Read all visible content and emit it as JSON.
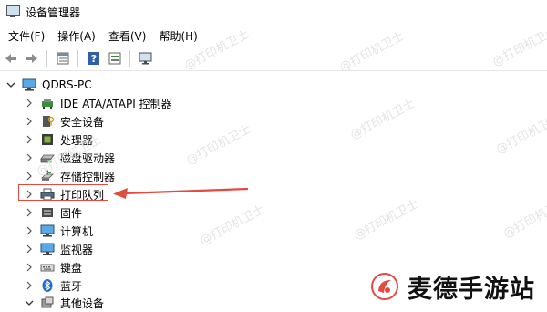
{
  "window": {
    "title": "设备管理器"
  },
  "menu": [
    {
      "label": "文件(F)"
    },
    {
      "label": "操作(A)"
    },
    {
      "label": "查看(V)"
    },
    {
      "label": "帮助(H)"
    }
  ],
  "toolbar": [
    "back-icon",
    "forward-icon",
    "properties-icon",
    "help-icon",
    "view-icon",
    "monitor-scan-icon"
  ],
  "tree": {
    "root": "QDRS-PC",
    "items": [
      {
        "label": "IDE ATA/ATAPI 控制器",
        "icon": "ide-controller-icon"
      },
      {
        "label": "安全设备",
        "icon": "security-device-icon"
      },
      {
        "label": "处理器",
        "icon": "processor-icon"
      },
      {
        "label": "磁盘驱动器",
        "icon": "disk-drive-icon"
      },
      {
        "label": "存储控制器",
        "icon": "storage-controller-icon"
      },
      {
        "label": "打印队列",
        "icon": "printer-icon"
      },
      {
        "label": "固件",
        "icon": "firmware-icon"
      },
      {
        "label": "计算机",
        "icon": "computer-icon"
      },
      {
        "label": "监视器",
        "icon": "monitor-icon"
      },
      {
        "label": "键盘",
        "icon": "keyboard-icon"
      },
      {
        "label": "蓝牙",
        "icon": "bluetooth-icon"
      },
      {
        "label": "其他设备",
        "icon": "other-devices-icon"
      }
    ]
  },
  "watermark": {
    "text": "@打印机卫士"
  },
  "brand": {
    "text": "麦德手游站"
  },
  "colors": {
    "annotation": "#e34b40",
    "bluetooth": "#1a6fd0"
  }
}
